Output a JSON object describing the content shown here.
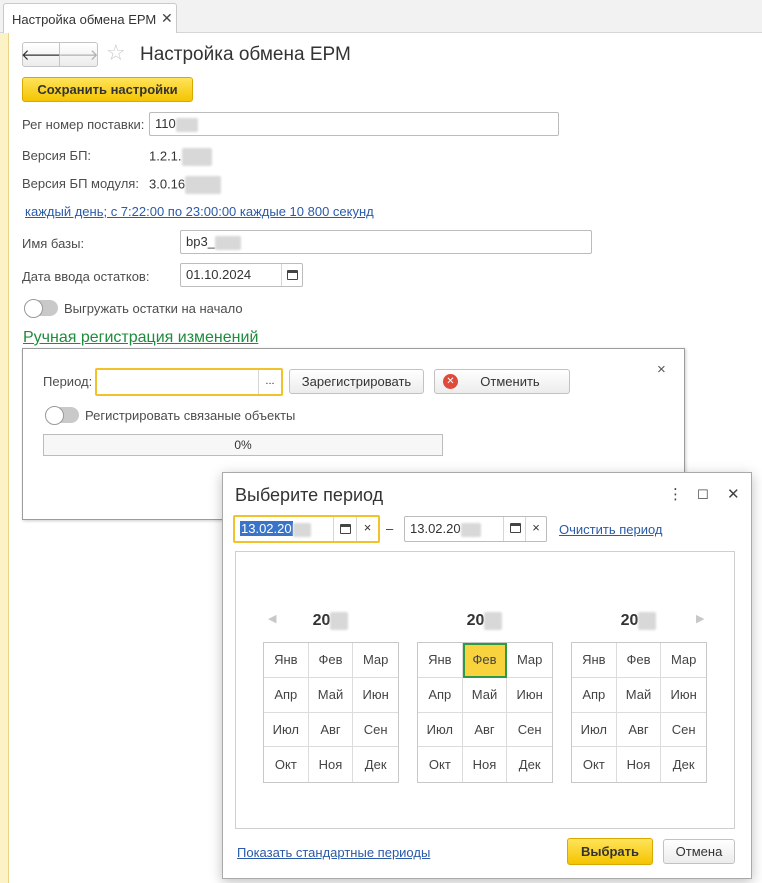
{
  "tab": {
    "title": "Настройка обмена ЕРМ",
    "close": "✕"
  },
  "nav": {
    "back": "🡐",
    "forward": "🡒",
    "star": "☆"
  },
  "page": {
    "title": "Настройка обмена ЕРМ"
  },
  "toolbar": {
    "save_label": "Сохранить настройки"
  },
  "fields": {
    "reg_number": {
      "label": "Рег номер поставки:",
      "value": "110"
    },
    "bp_version": {
      "label": "Версия БП:",
      "value": "1.2.1."
    },
    "bp_module_version": {
      "label": "Версия БП модуля:",
      "value": "3.0.16"
    },
    "schedule_link": "каждый день; с 7:22:00 по 23:00:00 каждые 10 800 секунд",
    "db_name": {
      "label": "Имя базы:",
      "value": "bp3_"
    },
    "balance_date": {
      "label": "Дата ввода остатков:",
      "value": "01.10.2024"
    },
    "export_balances": {
      "label": "Выгружать остатки на начало",
      "on": false
    }
  },
  "manual_section": {
    "title": "Ручная регистрация изменений",
    "period_label": "Период:",
    "period_value": "",
    "choose": "...",
    "register_button": "Зарегистрировать",
    "cancel_button": "Отменить",
    "register_related": {
      "label": "Регистрировать связаные объекты",
      "on": false
    },
    "progress": "0%",
    "close": "×"
  },
  "dialog": {
    "title": "Выберите период",
    "menu": "⋮",
    "maximize": "☐",
    "close": "✕",
    "date_from": "13.02.20",
    "date_to": "13.02.20",
    "dash": "–",
    "clear_x": "×",
    "clear_period": "Очистить период",
    "years": [
      "20",
      "20",
      "20"
    ],
    "months": [
      "Янв",
      "Фев",
      "Мар",
      "Апр",
      "Май",
      "Июн",
      "Июл",
      "Авг",
      "Сен",
      "Окт",
      "Ноя",
      "Дек"
    ],
    "selected": {
      "year_index": 1,
      "month_index": 1
    },
    "prev_arrow": "◀",
    "next_arrow": "▶",
    "show_standard": "Показать стандартные периоды",
    "select_button": "Выбрать",
    "cancel_button": "Отмена",
    "colors": {
      "accent": "#f8d33e",
      "selection_border": "#2e9a45"
    }
  }
}
